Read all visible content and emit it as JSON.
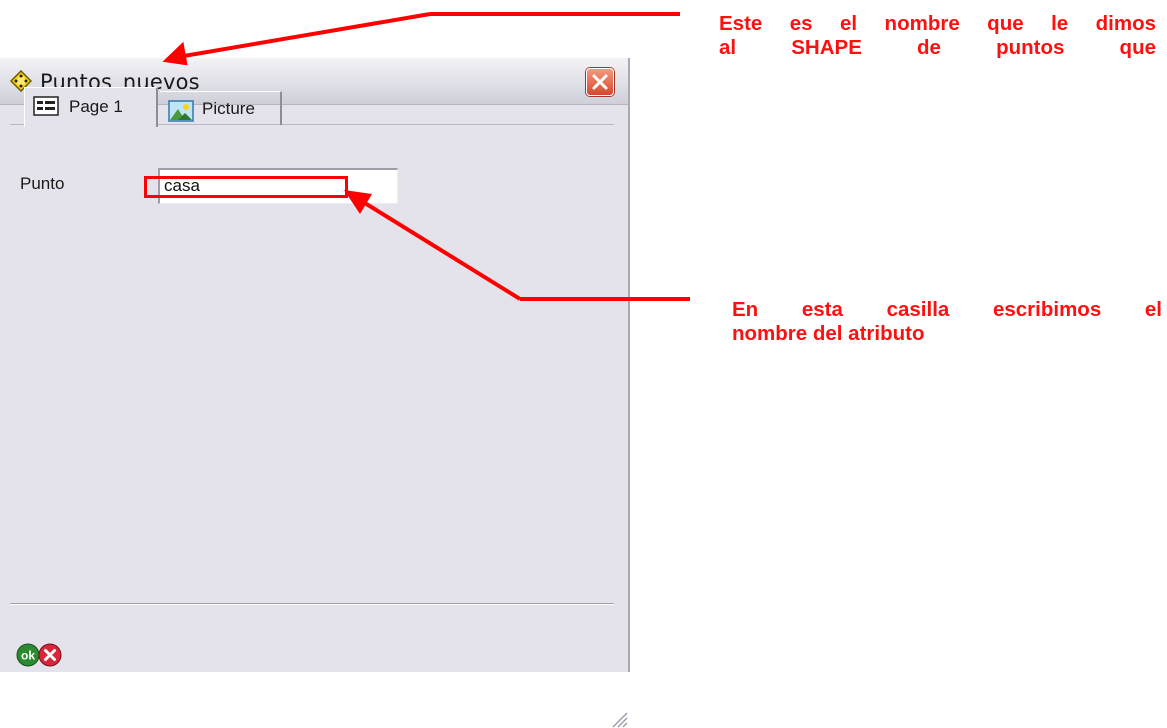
{
  "window": {
    "title": "Puntos_nuevos",
    "title_icon": "diamond-point-icon",
    "close_icon": "close-icon"
  },
  "tabs": [
    {
      "label": "Page 1",
      "icon": "form-page-icon",
      "active": true
    },
    {
      "label": "Picture",
      "icon": "picture-icon",
      "active": false
    }
  ],
  "form": {
    "field_label": "Punto",
    "field_value": "casa"
  },
  "buttons": {
    "ok_label": "ok",
    "ok_icon": "ok-icon",
    "cancel_icon": "cancel-icon"
  },
  "annotations": {
    "top_line1": "Este es el nombre que le dimos",
    "top_line2": "al SHAPE de puntos que",
    "mid_line1": "En esta casilla escribimos el",
    "mid_line2": "nombre del atributo",
    "color": "#ff0000"
  }
}
